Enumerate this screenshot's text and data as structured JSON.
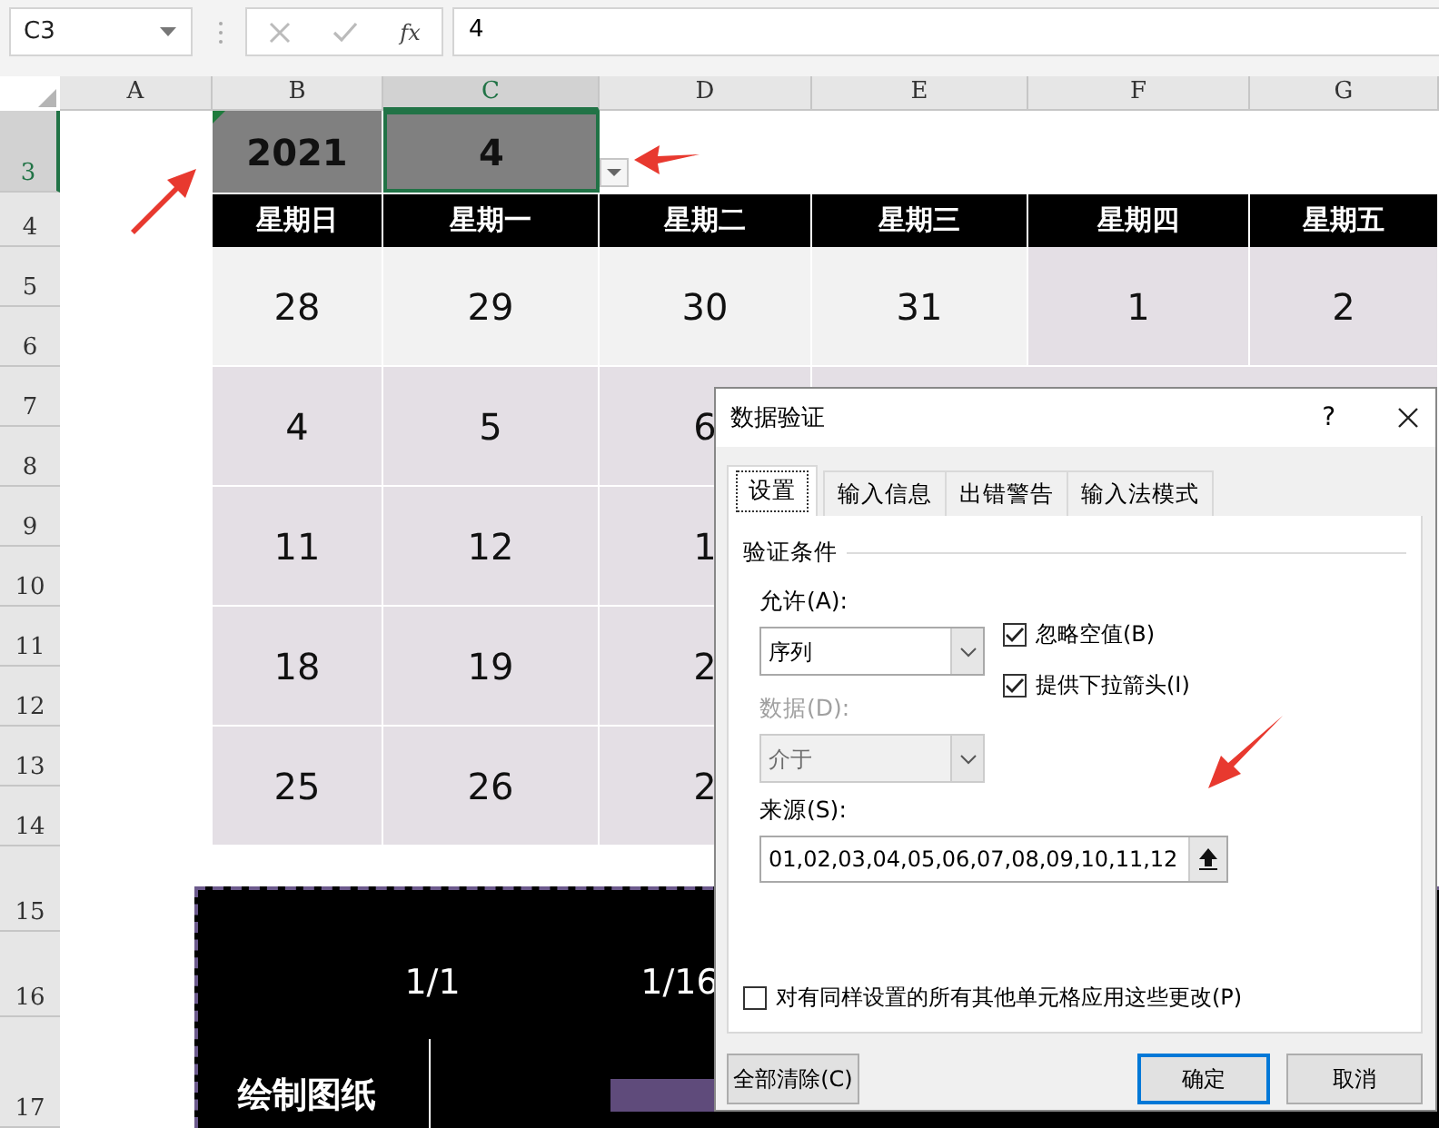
{
  "name_box": {
    "value": "C3"
  },
  "formula_bar": {
    "function_label": "fx",
    "value": "4"
  },
  "columns": [
    {
      "label": "A",
      "selected": false
    },
    {
      "label": "B",
      "selected": false
    },
    {
      "label": "C",
      "selected": true
    },
    {
      "label": "D",
      "selected": false
    },
    {
      "label": "E",
      "selected": false
    },
    {
      "label": "F",
      "selected": false
    },
    {
      "label": "G",
      "selected": false
    }
  ],
  "rows": [
    {
      "label": "3",
      "selected": true
    },
    {
      "label": "4",
      "selected": false
    },
    {
      "label": "5",
      "selected": false
    },
    {
      "label": "6",
      "selected": false
    },
    {
      "label": "7",
      "selected": false
    },
    {
      "label": "8",
      "selected": false
    },
    {
      "label": "9",
      "selected": false
    },
    {
      "label": "10",
      "selected": false
    },
    {
      "label": "11",
      "selected": false
    },
    {
      "label": "12",
      "selected": false
    },
    {
      "label": "13",
      "selected": false
    },
    {
      "label": "14",
      "selected": false
    },
    {
      "label": "15",
      "selected": false
    },
    {
      "label": "16",
      "selected": false
    },
    {
      "label": "17",
      "selected": false
    }
  ],
  "calendar": {
    "year": "2021",
    "month": "4",
    "month_selected": true,
    "weekdays": [
      "星期日",
      "星期一",
      "星期二",
      "星期三",
      "星期四",
      "星期五"
    ],
    "weeks": [
      {
        "cells": [
          {
            "day": "28",
            "in_month": false
          },
          {
            "day": "29",
            "in_month": false
          },
          {
            "day": "30",
            "in_month": false
          },
          {
            "day": "31",
            "in_month": false
          },
          {
            "day": "1",
            "in_month": true
          },
          {
            "day": "2",
            "in_month": true
          }
        ]
      },
      {
        "cells": [
          {
            "day": "4",
            "in_month": true
          },
          {
            "day": "5",
            "in_month": true
          },
          {
            "day": "6",
            "in_month": true
          }
        ]
      },
      {
        "cells": [
          {
            "day": "11",
            "in_month": true
          },
          {
            "day": "12",
            "in_month": true
          },
          {
            "day": "1",
            "in_month": true
          }
        ]
      },
      {
        "cells": [
          {
            "day": "18",
            "in_month": true
          },
          {
            "day": "19",
            "in_month": true
          },
          {
            "day": "2",
            "in_month": true
          }
        ]
      },
      {
        "cells": [
          {
            "day": "25",
            "in_month": true
          },
          {
            "day": "26",
            "in_month": true
          },
          {
            "day": "2",
            "in_month": true
          }
        ]
      }
    ]
  },
  "gantt": {
    "dates": [
      "1/1",
      "1/16"
    ],
    "tasks": [
      {
        "name": "绘制图纸"
      }
    ]
  },
  "dialog": {
    "title": "数据验证",
    "help": "?",
    "tabs": [
      {
        "label": "设置",
        "selected": true
      },
      {
        "label": "输入信息",
        "selected": false
      },
      {
        "label": "出错警告",
        "selected": false
      },
      {
        "label": "输入法模式",
        "selected": false
      }
    ],
    "group_title": "验证条件",
    "fields": [
      {
        "label": "允许(A):",
        "value": "序列",
        "disabled": false
      },
      {
        "label": "数据(D):",
        "value": "介于",
        "disabled": true
      }
    ],
    "options": [
      {
        "label": "忽略空值(B)",
        "checked": true
      },
      {
        "label": "提供下拉箭头(I)",
        "checked": true
      }
    ],
    "source": {
      "label": "来源(S):",
      "value": "01,02,03,04,05,06,07,08,09,10,11,12"
    },
    "apply_all": {
      "label": "对有同样设置的所有其他单元格应用这些更改(P)",
      "checked": false
    },
    "buttons": [
      {
        "label": "全部清除(C)",
        "kind": "secondary"
      },
      {
        "label": "确定",
        "kind": "default"
      },
      {
        "label": "取消",
        "kind": "secondary"
      }
    ]
  }
}
